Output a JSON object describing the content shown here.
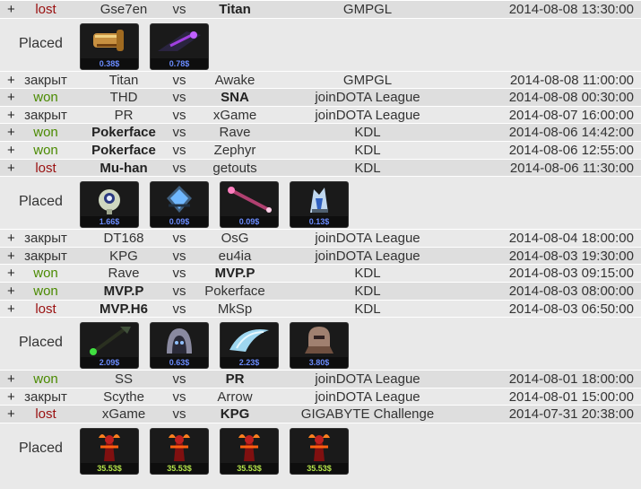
{
  "placed_label": "Placed",
  "vs_label": "vs",
  "entries": [
    {
      "kind": "match",
      "plus": "+",
      "result": "lost",
      "result_class": "lost",
      "team1": "Gse7en",
      "team1_bold": false,
      "team2": "Titan",
      "team2_bold": true,
      "league": "GMPGL",
      "datetime": "2014-08-08 13:30:00"
    },
    {
      "kind": "placed",
      "items": [
        {
          "icon": "golden-cannon-item-icon",
          "price": "0.38$"
        },
        {
          "icon": "dark-blade-item-icon",
          "price": "0.78$"
        }
      ]
    },
    {
      "kind": "match",
      "plus": "+",
      "result": "закрыт",
      "result_class": "closed",
      "team1": "Titan",
      "team1_bold": false,
      "team2": "Awake",
      "team2_bold": false,
      "league": "GMPGL",
      "datetime": "2014-08-08 11:00:00"
    },
    {
      "kind": "match",
      "plus": "+",
      "result": "won",
      "result_class": "won",
      "team1": "THD",
      "team1_bold": false,
      "team2": "SNA",
      "team2_bold": true,
      "league": "joinDOTA League",
      "datetime": "2014-08-08 00:30:00"
    },
    {
      "kind": "match",
      "plus": "+",
      "result": "закрыт",
      "result_class": "closed",
      "team1": "PR",
      "team1_bold": false,
      "team2": "xGame",
      "team2_bold": false,
      "league": "joinDOTA League",
      "datetime": "2014-08-07 16:00:00"
    },
    {
      "kind": "match",
      "plus": "+",
      "result": "won",
      "result_class": "won",
      "team1": "Pokerface",
      "team1_bold": true,
      "team2": "Rave",
      "team2_bold": false,
      "league": "KDL",
      "datetime": "2014-08-06 14:42:00"
    },
    {
      "kind": "match",
      "plus": "+",
      "result": "won",
      "result_class": "won",
      "team1": "Pokerface",
      "team1_bold": true,
      "team2": "Zephyr",
      "team2_bold": false,
      "league": "KDL",
      "datetime": "2014-08-06 12:55:00"
    },
    {
      "kind": "match",
      "plus": "+",
      "result": "lost",
      "result_class": "lost",
      "team1": "Mu-han",
      "team1_bold": true,
      "team2": "getouts",
      "team2_bold": false,
      "league": "KDL",
      "datetime": "2014-08-06 11:30:00"
    },
    {
      "kind": "placed",
      "items": [
        {
          "icon": "ward-courier-item-icon",
          "price": "1.66$"
        },
        {
          "icon": "blue-crystal-item-icon",
          "price": "0.09$"
        },
        {
          "icon": "pink-staff-item-icon",
          "price": "0.09$"
        },
        {
          "icon": "ice-armor-item-icon",
          "price": "0.13$"
        }
      ]
    },
    {
      "kind": "match",
      "plus": "+",
      "result": "закрыт",
      "result_class": "closed",
      "team1": "DT168",
      "team1_bold": false,
      "team2": "OsG",
      "team2_bold": false,
      "league": "joinDOTA League",
      "datetime": "2014-08-04 18:00:00"
    },
    {
      "kind": "match",
      "plus": "+",
      "result": "закрыт",
      "result_class": "closed",
      "team1": "KPG",
      "team1_bold": false,
      "team2": "eu4ia",
      "team2_bold": false,
      "league": "joinDOTA League",
      "datetime": "2014-08-03 19:30:00"
    },
    {
      "kind": "match",
      "plus": "+",
      "result": "won",
      "result_class": "won",
      "team1": "Rave",
      "team1_bold": false,
      "team2": "MVP.P",
      "team2_bold": true,
      "league": "KDL",
      "datetime": "2014-08-03 09:15:00"
    },
    {
      "kind": "match",
      "plus": "+",
      "result": "won",
      "result_class": "won",
      "team1": "MVP.P",
      "team1_bold": true,
      "team2": "Pokerface",
      "team2_bold": false,
      "league": "KDL",
      "datetime": "2014-08-03 08:00:00"
    },
    {
      "kind": "match",
      "plus": "+",
      "result": "lost",
      "result_class": "lost",
      "team1": "MVP.H6",
      "team1_bold": true,
      "team2": "MkSp",
      "team2_bold": false,
      "league": "KDL",
      "datetime": "2014-08-03 06:50:00"
    },
    {
      "kind": "placed",
      "items": [
        {
          "icon": "scepter-item-icon",
          "price": "2.09$"
        },
        {
          "icon": "hood-item-icon",
          "price": "0.63$"
        },
        {
          "icon": "crystal-blade-item-icon",
          "price": "2.23$"
        },
        {
          "icon": "helmet-item-icon",
          "price": "3.80$"
        }
      ]
    },
    {
      "kind": "match",
      "plus": "+",
      "result": "won",
      "result_class": "won",
      "team1": "SS",
      "team1_bold": false,
      "team2": "PR",
      "team2_bold": true,
      "league": "joinDOTA League",
      "datetime": "2014-08-01 18:00:00"
    },
    {
      "kind": "match",
      "plus": "+",
      "result": "закрыт",
      "result_class": "closed",
      "team1": "Scythe",
      "team1_bold": false,
      "team2": "Arrow",
      "team2_bold": false,
      "league": "joinDOTA League",
      "datetime": "2014-08-01 15:00:00"
    },
    {
      "kind": "match",
      "plus": "+",
      "result": "lost",
      "result_class": "lost",
      "team1": "xGame",
      "team1_bold": false,
      "team2": "KPG",
      "team2_bold": true,
      "league": "GIGABYTE Challenge",
      "datetime": "2014-07-31 20:38:00"
    },
    {
      "kind": "placed",
      "items": [
        {
          "icon": "fire-figure-item-icon",
          "price": "35.53$"
        },
        {
          "icon": "fire-figure-item-icon",
          "price": "35.53$"
        },
        {
          "icon": "fire-figure-item-icon",
          "price": "35.53$"
        },
        {
          "icon": "fire-figure-item-icon",
          "price": "35.53$"
        }
      ]
    }
  ]
}
